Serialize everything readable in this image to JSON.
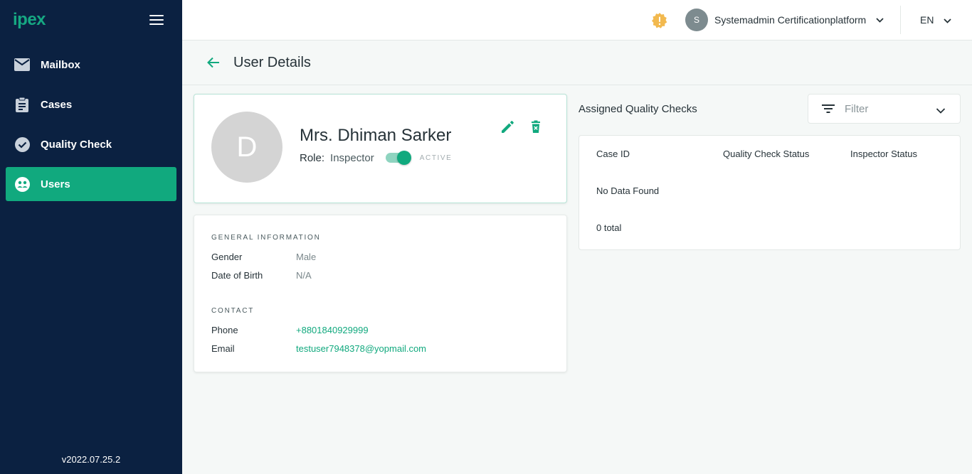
{
  "sidebar": {
    "logo": "ipex",
    "items": [
      {
        "label": "Mailbox",
        "icon": "mail-icon"
      },
      {
        "label": "Cases",
        "icon": "clipboard-icon"
      },
      {
        "label": "Quality Check",
        "icon": "check-circle-icon"
      },
      {
        "label": "Users",
        "icon": "users-icon",
        "active": true
      }
    ],
    "version": "v2022.07.25.2"
  },
  "header": {
    "user_initial": "S",
    "user_name": "Systemadmin Certificationplatform",
    "language": "EN",
    "alert_icon": "alert-badge-icon"
  },
  "page": {
    "title": "User Details"
  },
  "profile": {
    "initial": "D",
    "name": "Mrs. Dhiman Sarker",
    "role_label": "Role:",
    "role_value": "Inspector",
    "status": "ACTIVE",
    "active": true
  },
  "general": {
    "title": "GENERAL INFORMATION",
    "gender_label": "Gender",
    "gender_value": "Male",
    "dob_label": "Date of Birth",
    "dob_value": "N/A"
  },
  "contact": {
    "title": "CONTACT",
    "phone_label": "Phone",
    "phone_value": "+8801840929999",
    "email_label": "Email",
    "email_value": "testuser7948378@yopmail.com"
  },
  "assigned": {
    "title": "Assigned Quality Checks",
    "filter_placeholder": "Filter",
    "columns": [
      "Case ID",
      "Quality Check Status",
      "Inspector Status"
    ],
    "empty_text": "No Data Found",
    "total_text": "0 total"
  },
  "colors": {
    "sidebar_bg": "#0b2141",
    "accent": "#11a97e",
    "alert": "#f2b94f"
  }
}
